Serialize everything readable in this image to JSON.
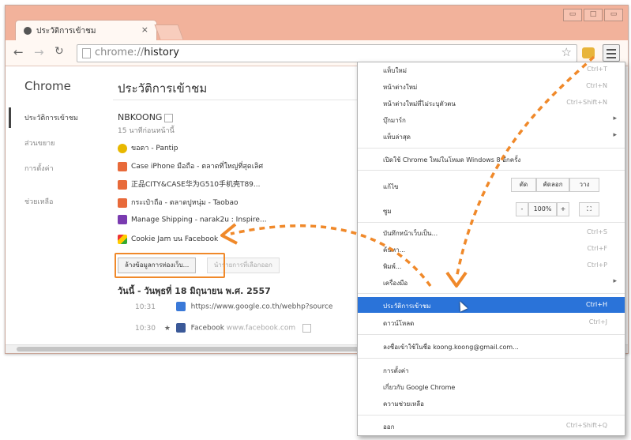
{
  "browser": {
    "tab_title": "ประวัติการเข้าชม",
    "tab_close": "×",
    "url_prefix": "chrome://",
    "url_path": "history",
    "window_buttons": [
      "▭",
      "□",
      "▭"
    ]
  },
  "sidebar": {
    "brand": "Chrome",
    "items": [
      "ประวัติการเข้าชม",
      "ส่วนขยาย",
      "การตั้งค่า"
    ],
    "bottom": "ช่วยเหลือ"
  },
  "main": {
    "title": "ประวัติการเข้าชม",
    "device": "NBKOONG",
    "device_sub": "15 นาทีก่อนหน้านี้",
    "open_tabs": [
      {
        "label": "ขอดา - Pantip",
        "color": "#e8b800"
      },
      {
        "label": "Case iPhone มือถือ - ตลาดที่ใหญ่ที่สุดเลิศ",
        "color": "#e86a3a"
      },
      {
        "label": "正品CITY&CASE华为G510手机壳T89...",
        "color": "#e86a3a"
      },
      {
        "label": "กระเป๋าถือ - ตลาดปูหนุ่ม - Taobao",
        "color": "#e86a3a"
      },
      {
        "label": "Manage Shipping - narak2u : Inspire...",
        "color": "#7a3bb0"
      },
      {
        "label": "Cookie Jam บน Facebook",
        "color": "#d63b8a"
      }
    ],
    "clear_button": "ล้างข้อมูลการท่องเว็บ...",
    "remove_button": "นำรายการที่เลือกออก",
    "date_heading": "วันนี้ - วันพุธที่ 18 มิถุนายน พ.ศ. 2557",
    "history": [
      {
        "time": "10:31",
        "star": "",
        "icon_color": "#3a79d8",
        "title": "https://www.google.co.th/webhp?source",
        "domain": ""
      },
      {
        "time": "10:30",
        "star": "★",
        "icon_color": "#3b5998",
        "title": "Facebook",
        "domain": "www.facebook.com"
      }
    ]
  },
  "menu": {
    "items": [
      {
        "label": "แท็บใหม่",
        "shortcut": "Ctrl+T"
      },
      {
        "label": "หน้าต่างใหม่",
        "shortcut": "Ctrl+N"
      },
      {
        "label": "หน้าต่างใหม่ที่ไม่ระบุตัวตน",
        "shortcut": "Ctrl+Shift+N"
      },
      {
        "label": "บุ๊กมาร์ก",
        "shortcut": ""
      },
      {
        "label": "แท็บล่าสุด",
        "shortcut": ""
      }
    ],
    "relaunch": "เปิดใช้ Chrome ใหม่ในโหมด Windows 8 อีกครั้ง",
    "edit_label": "แก้ไข",
    "edit_buttons": [
      "ตัด",
      "คัดลอก",
      "วาง"
    ],
    "zoom_label": "ซูม",
    "zoom_minus": "-",
    "zoom_value": "100%",
    "zoom_plus": "+",
    "zoom_full": "⛶",
    "items2": [
      {
        "label": "บันทึกหน้าเว็บเป็น...",
        "shortcut": "Ctrl+S"
      },
      {
        "label": "ค้นหา...",
        "shortcut": "Ctrl+F"
      },
      {
        "label": "พิมพ์...",
        "shortcut": "Ctrl+P"
      },
      {
        "label": "เครื่องมือ",
        "shortcut": ""
      }
    ],
    "history_item": {
      "label": "ประวัติการเข้าชม",
      "shortcut": "Ctrl+H"
    },
    "downloads_item": {
      "label": "ดาวน์โหลด",
      "shortcut": "Ctrl+J"
    },
    "signin": "ลงชื่อเข้าใช้ในชื่อ koong.koong@gmail.com...",
    "items3": [
      "การตั้งค่า",
      "เกี่ยวกับ Google Chrome",
      "ความช่วยเหลือ"
    ],
    "exit": {
      "label": "ออก",
      "shortcut": "Ctrl+Shift+Q"
    }
  },
  "colors": {
    "titlebar": "#f2b29b",
    "accent_orange": "#f0892a",
    "menu_selected": "#2a73d9"
  }
}
